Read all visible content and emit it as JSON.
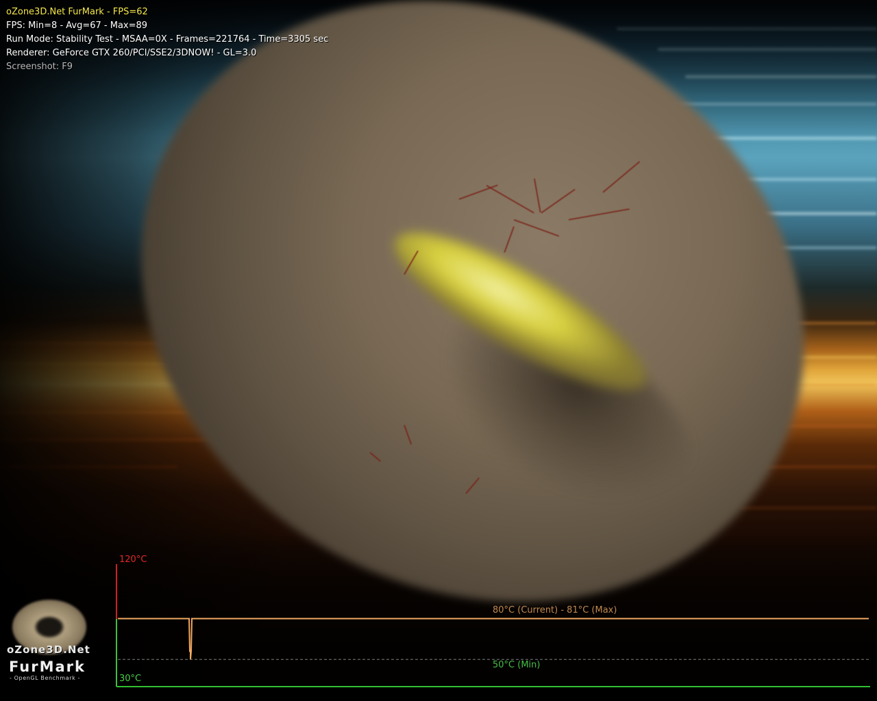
{
  "hud": {
    "title": "oZone3D.Net FurMark - FPS=62",
    "fps_stats": "FPS: Min=8 - Avg=67 - Max=89",
    "run_mode": "Run Mode: Stability Test - MSAA=0X - Frames=221764 - Time=3305 sec",
    "renderer": "Renderer: GeForce GTX 260/PCI/SSE2/3DNOW! - GL=3.0",
    "screenshot_hint": "Screenshot: F9"
  },
  "temperature_graph": {
    "scale_max_label": "120°C",
    "scale_min_label": "30°C",
    "current_label": "80°C (Current) - 81°C (Max)",
    "min_label": "50°C (Min)",
    "scale_max": 120,
    "scale_min": 30,
    "current": 80,
    "max": 81,
    "min": 50,
    "colors": {
      "axis_top": "#d02020",
      "axis_bottom": "#40c040",
      "current_line": "#f0a860",
      "min_line": "#808080"
    }
  },
  "logo": {
    "site": "oZone3D.Net",
    "name": "FurMark",
    "tagline": "- OpenGL Benchmark -"
  },
  "scene": {
    "subject": "fur-torus",
    "accent_colors": {
      "fur": "#7a6a55",
      "sky": "#5ba3bd",
      "flare": "#f0c45a",
      "glow": "#d8d040"
    }
  }
}
